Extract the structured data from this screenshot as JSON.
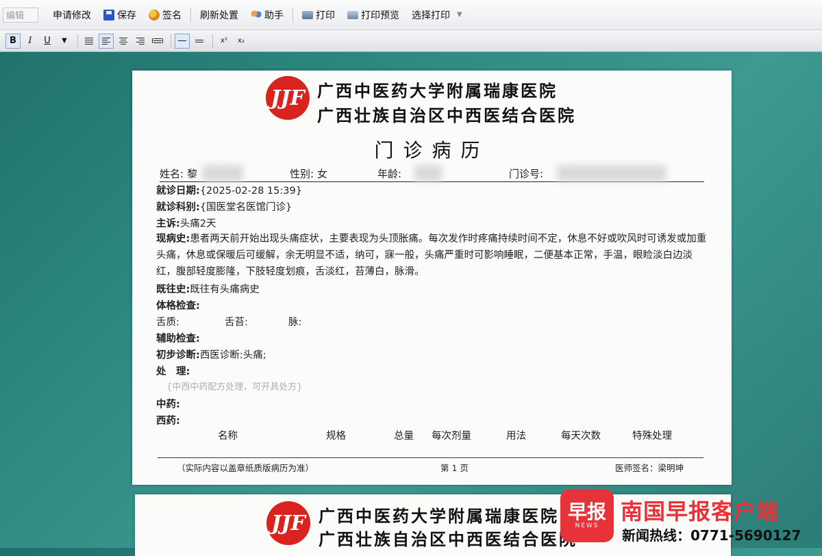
{
  "toolbar": {
    "mode": "编辑",
    "buttons": {
      "request_edit": "申请修改",
      "save": "保存",
      "sign": "签名",
      "refresh": "刷新处置",
      "helper": "助手",
      "print": "打印",
      "print_preview": "打印预览",
      "select_print": "选择打印"
    }
  },
  "format_bar": {
    "bold": "B",
    "italic": "I",
    "underline": "U",
    "superscript": "x²",
    "subscript": "x₂"
  },
  "document": {
    "hospital_name_1": "广西中医药大学附属瑞康医院",
    "hospital_name_2": "广西壮族自治区中西医结合医院",
    "logo_text": "JJF",
    "title": "门诊病历",
    "patient": {
      "name_label": "姓名:",
      "name_value": "黎",
      "gender_label": "性别:",
      "gender_value": "女",
      "age_label": "年龄:",
      "clinic_no_label": "门诊号:"
    },
    "visit_date_label": "就诊日期:",
    "visit_date_value": "{2025-02-28 15:39}",
    "department_label": "就诊科别:",
    "department_value": "{国医堂名医馆门诊}",
    "complaint_label": "主诉:",
    "complaint_value": "头痛2天",
    "history_label": "现病史:",
    "history_value": "患者两天前开始出现头痛症状，主要表现为头顶胀痛。每次发作时疼痛持续时间不定，休息不好或吹风时可诱发或加重头痛，休息或保暖后可缓解，余无明显不适，纳可，寐一般，头痛严重时可影响睡眠，二便基本正常，手温，眼睑淡白边淡红，腹部轻度膨隆，下肢轻度划痕，舌淡红，苔薄白，脉滑。",
    "past_history_label": "既往史:",
    "past_history_value": "既往有头痛病史",
    "physical_exam_label": "体格检查:",
    "tongue_label": "舌质:",
    "coating_label": "舌苔:",
    "pulse_label": "脉:",
    "aux_exam_label": "辅助检查:",
    "prelim_diag_label": "初步诊断:",
    "prelim_diag_value": "西医诊断:头痛;",
    "treatment_label": "处　理:",
    "treatment_placeholder": "{中西中药配方处理，可开具处方}",
    "tcm_label": "中药:",
    "western_label": "西药:",
    "med_columns": [
      "名称",
      "规格",
      "总量",
      "每次剂量",
      "用法",
      "每天次数",
      "特殊处理"
    ],
    "footer_note": "（实际内容以盖章纸质版病历为准）",
    "footer_page": "第 1 页",
    "footer_signature": "医师签名：梁明坤"
  },
  "watermark": {
    "badge_text": "早报",
    "badge_sub": "NEWS",
    "brand": "南国早报客户端",
    "hotline": "新闻热线：0771-5690127"
  }
}
